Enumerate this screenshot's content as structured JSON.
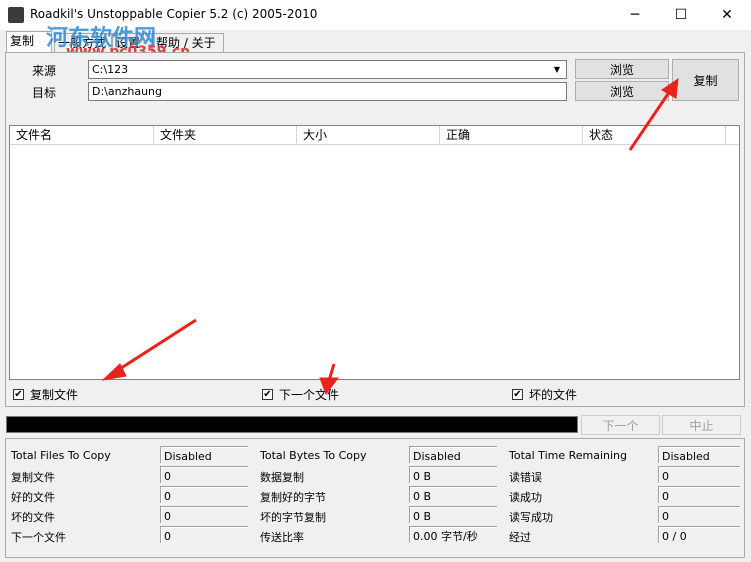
{
  "window": {
    "title": "Roadkil's Unstoppable Copier 5.2 (c) 2005-2010",
    "minimize_glyph": "─",
    "maximize_glyph": "☐",
    "close_glyph": "✕"
  },
  "watermark": {
    "main": "河东软件网",
    "sub": "www.pc0359.cn"
  },
  "tabs": [
    {
      "label": "复制"
    },
    {
      "label": "一般方式"
    },
    {
      "label": "设置"
    },
    {
      "label": "帮助 / 关于"
    }
  ],
  "copy": {
    "source_label": "来源",
    "source_value": "C:\\123",
    "target_label": "目标",
    "target_value": "D:\\anzhaung",
    "browse_label": "浏览",
    "copy_label": "复制",
    "dropdown_icon": "▼"
  },
  "list": {
    "columns": [
      "文件名",
      "文件夹",
      "大小",
      "正确",
      "状态"
    ]
  },
  "checks": [
    {
      "label": "复制文件",
      "checked": true
    },
    {
      "label": "下一个文件",
      "checked": true
    },
    {
      "label": "坏的文件",
      "checked": true
    }
  ],
  "check_glyph": "✔",
  "controls": {
    "progress": 1.0,
    "next_label": "下一个",
    "abort_label": "中止"
  },
  "stats": {
    "col1": [
      {
        "label": "Total Files To Copy",
        "value": "Disabled"
      },
      {
        "label": "复制文件",
        "value": "0"
      },
      {
        "label": "好的文件",
        "value": "0"
      },
      {
        "label": "坏的文件",
        "value": "0"
      },
      {
        "label": "下一个文件",
        "value": "0"
      }
    ],
    "col2": [
      {
        "label": "Total Bytes To Copy",
        "value": "Disabled"
      },
      {
        "label": "数据复制",
        "value": "0 B"
      },
      {
        "label": "复制好的字节",
        "value": "0 B"
      },
      {
        "label": "坏的字节复制",
        "value": "0 B"
      },
      {
        "label": "传送比率",
        "value": "0.00 字节/秒"
      }
    ],
    "col3": [
      {
        "label": "Total Time Remaining",
        "value": "Disabled"
      },
      {
        "label": "读错误",
        "value": "0"
      },
      {
        "label": "读成功",
        "value": "0"
      },
      {
        "label": "读写成功",
        "value": "0"
      },
      {
        "label": "经过",
        "value": "0 / 0"
      }
    ]
  },
  "colors": {
    "accent_arrow": "#e8231c",
    "progress_fill": "#000000"
  }
}
